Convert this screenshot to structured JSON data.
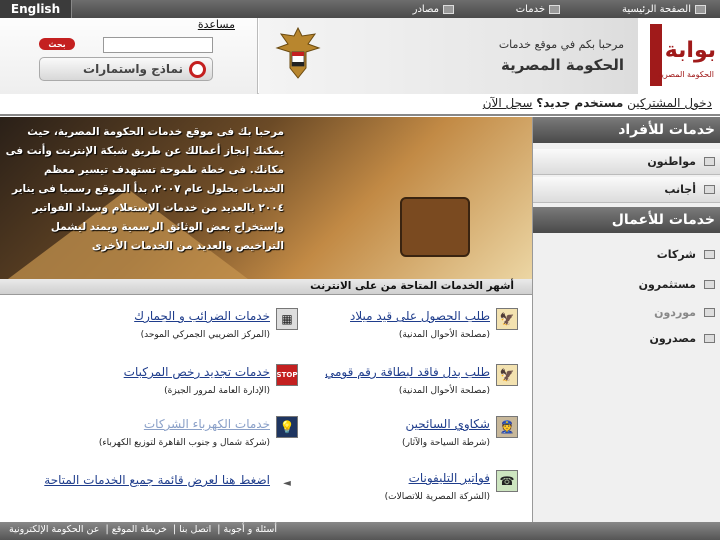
{
  "topnav": {
    "english": "English",
    "items": [
      "الصفحة الرئيسية",
      "خدمات",
      "مصادر"
    ]
  },
  "search": {
    "help": "مساعدة",
    "button": "بحث",
    "placeholder": "",
    "forms": "نماذج واستمارات"
  },
  "banner": {
    "welcome": "مرحبا بكم في موقع خدمات",
    "portal": "الحكومة المصرية",
    "logo": "بوابة",
    "logo_sub": "الحكومة المصرية"
  },
  "login": {
    "part1": "دخول المشتركين",
    "part2": "مستخدم جديد؟",
    "part3": "سجل الآن"
  },
  "hero": {
    "text": "مرحبا بك فى موقع خدمات الحكومة المصرية، حيث يمكنك إنجاز أعمالك عن طريق شبكة الإنترنت وأنت فى مكانك. فى خطة طموحة تستهدف تيسير معظم الخدمات بحلول عام ٢٠٠٧، بدأ الموقع رسميا فى يناير ٢٠٠٤ بالعديد من خدمات الإستعلام وسداد الفواتير وإستخراج بعض الوثائق الرسمية ويمتد ليشمل التراخيص والعديد من الخدمات الأخرى"
  },
  "sidebar": {
    "individuals": "خدمات للأفراد",
    "citizens": "مواطنون",
    "foreigners": "أجانب",
    "business": "خدمات للأعمال",
    "companies": "شركات",
    "investors": "مستثمرون",
    "importers": "موردون",
    "exporters": "مصدرون"
  },
  "services": {
    "title": "أشهر الخدمات المتاحة من على الانترنت",
    "items": [
      {
        "title": "طلب الحصول على قيد ميلاد",
        "source": "(مصلحة الأحوال المدنية)",
        "icon": "eagle-icon"
      },
      {
        "title": "خدمات الضرائب و الجمارك",
        "source": "(المركز الضريبي الجمركي الموحد)",
        "icon": "calculator-icon"
      },
      {
        "title": "طلب بدل فاقد لبطاقة رقم قومي",
        "source": "(مصلحة الأحوال المدنية)",
        "icon": "eagle-icon"
      },
      {
        "title": "خدمات تجديد رخص المركبات",
        "source": "(الإدارة العامة لمرور الجيزة)",
        "icon": "stop-icon"
      },
      {
        "title": "شكاوي السائحين",
        "source": "(شرطة السياحة والآثار)",
        "icon": "officer-icon"
      },
      {
        "title": "خدمات الكهرباء الشركات",
        "source": "(شركة شمال و جنوب القاهرة لتوزيع الكهرباء)",
        "icon": "bulb-icon"
      },
      {
        "title": "فواتير التليفونات",
        "source": "(الشركة المصرية للاتصالات)",
        "icon": "phone-icon"
      },
      {
        "title": "اضغط هنا لعرض قائمة جميع الخدمات المتاحة",
        "source": "",
        "icon": "arrow-icon"
      }
    ]
  },
  "footer": {
    "links": [
      "عن الحكومة الإلكترونية",
      "خريطة الموقع",
      "اتصل بنا",
      "أسئلة و أجوبة"
    ]
  }
}
